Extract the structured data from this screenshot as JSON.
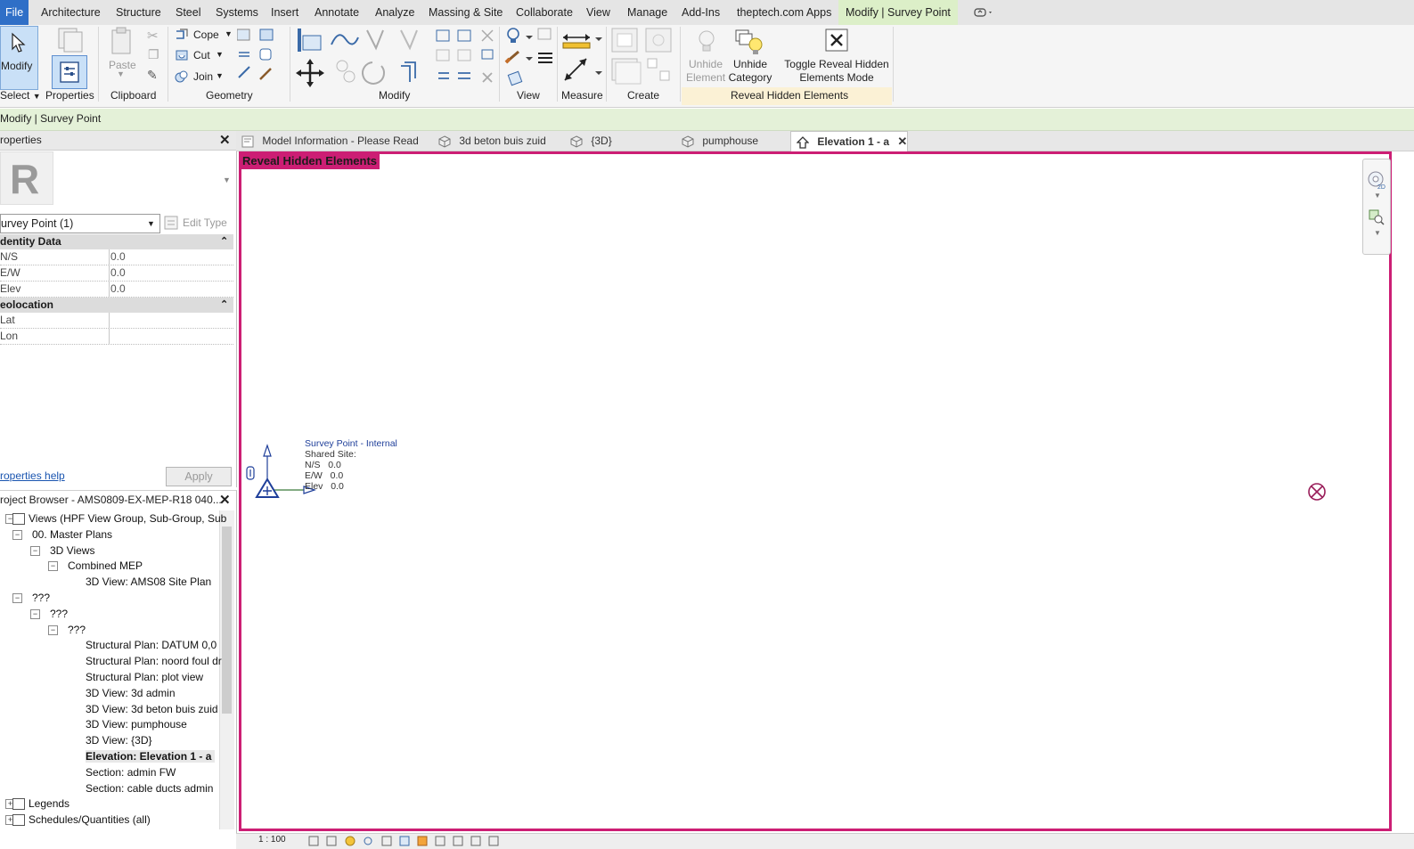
{
  "menu": {
    "file": "File",
    "items": [
      "Architecture",
      "Structure",
      "Steel",
      "Systems",
      "Insert",
      "Annotate",
      "Analyze",
      "Massing & Site",
      "Collaborate",
      "View",
      "Manage",
      "Add-Ins",
      "theptech.com Apps",
      "Modify | Survey Point"
    ]
  },
  "ribbon": {
    "modify_label": "Modify",
    "properties_label": "Properties",
    "paste_label": "Paste",
    "cope_label": "Cope",
    "cut_label": "Cut",
    "join_label": "Join",
    "unhide_element": "Unhide Element",
    "unhide_category": "Unhide Category",
    "toggle_reveal": "Toggle Reveal Hidden Elements Mode",
    "panels": {
      "select": "Select",
      "properties": "Properties",
      "clipboard": "Clipboard",
      "geometry": "Geometry",
      "modify": "Modify",
      "view": "View",
      "measure": "Measure",
      "create": "Create",
      "reveal": "Reveal Hidden Elements"
    }
  },
  "context_bar": {
    "label": "Modify | Survey Point"
  },
  "properties": {
    "title": "roperties",
    "type_selector": "urvey Point (1)",
    "edit_type": "Edit Type",
    "groups": [
      {
        "name": "dentity Data",
        "rows": [
          {
            "key": "N/S",
            "value": "0.0"
          },
          {
            "key": "E/W",
            "value": "0.0"
          },
          {
            "key": "Elev",
            "value": "0.0"
          }
        ]
      },
      {
        "name": "eolocation",
        "rows": [
          {
            "key": "Lat",
            "value": ""
          },
          {
            "key": "Lon",
            "value": ""
          }
        ]
      }
    ],
    "help_link": "roperties help",
    "apply": "Apply"
  },
  "project_browser": {
    "title": "roject Browser - AMS0809-EX-MEP-R18 040...",
    "items": [
      {
        "label": "Views (HPF View Group, Sub-Group, Sub",
        "level": 0
      },
      {
        "label": "00. Master Plans",
        "level": 1
      },
      {
        "label": "3D Views",
        "level": 2
      },
      {
        "label": "Combined MEP",
        "level": 3
      },
      {
        "label": "3D View: AMS08 Site Plan",
        "level": 4
      },
      {
        "label": "???",
        "level": 1
      },
      {
        "label": "???",
        "level": 2
      },
      {
        "label": "???",
        "level": 3
      },
      {
        "label": "Structural Plan: DATUM 0,0",
        "level": 4
      },
      {
        "label": "Structural Plan: noord foul dr",
        "level": 4
      },
      {
        "label": "Structural Plan: plot view",
        "level": 4
      },
      {
        "label": "3D View: 3d admin",
        "level": 4
      },
      {
        "label": "3D View: 3d beton buis zuid",
        "level": 4
      },
      {
        "label": "3D View: pumphouse",
        "level": 4
      },
      {
        "label": "3D View: {3D}",
        "level": 4
      },
      {
        "label": "Elevation: Elevation 1 - a",
        "level": 4
      },
      {
        "label": "Section: admin FW",
        "level": 4
      },
      {
        "label": "Section: cable ducts admin",
        "level": 4
      },
      {
        "label": "Legends",
        "level": 0
      },
      {
        "label": "Schedules/Quantities (all)",
        "level": 0
      }
    ]
  },
  "tabs": [
    {
      "label": "Model Information - Please Read"
    },
    {
      "label": "3d beton buis zuid"
    },
    {
      "label": "{3D}"
    },
    {
      "label": "pumphouse"
    },
    {
      "label": "Elevation 1 - a"
    }
  ],
  "canvas": {
    "banner": "Reveal Hidden Elements",
    "survey_point": {
      "title": "Survey Point - Internal",
      "line1": "Shared Site:",
      "ns_label": "N/S",
      "ns_value": "0.0",
      "ew_label": "E/W",
      "ew_value": "0.0",
      "elev_label": "Elev",
      "elev_value": "0.0"
    }
  },
  "status": {
    "scale": "1 : 100"
  },
  "colors": {
    "reveal": "#cc1e74",
    "file": "#2f6fc7",
    "context": "#e4f1d8",
    "annotation": "#1f3f9a"
  }
}
